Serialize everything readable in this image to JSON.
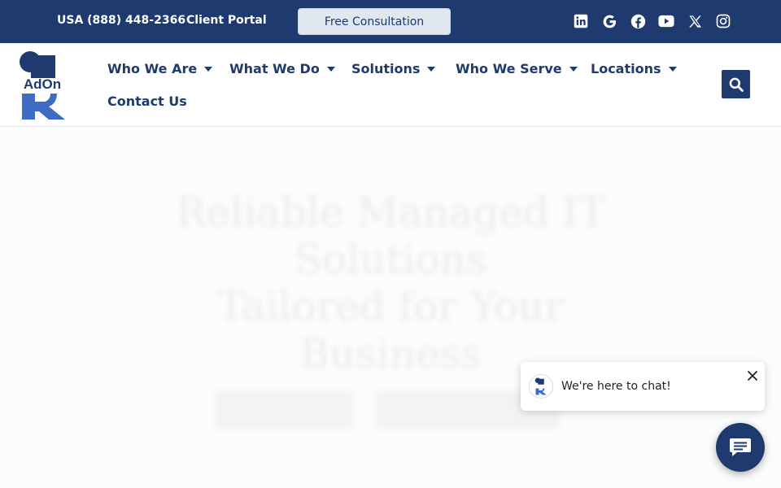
{
  "topbar": {
    "phone": "USA (888) 448-2366",
    "client_portal": "Client Portal",
    "consult_button": "Free Consultation",
    "social_icons": [
      "linkedin-icon",
      "google-icon",
      "facebook-icon",
      "youtube-icon",
      "x-icon",
      "instagram-icon"
    ]
  },
  "logo": {
    "text": "AdOn"
  },
  "nav": {
    "items": [
      {
        "label": "Who We Are",
        "dropdown": true
      },
      {
        "label": "What We Do",
        "dropdown": true
      },
      {
        "label": "Solutions",
        "dropdown": true
      },
      {
        "label": "Who We Serve",
        "dropdown": true
      },
      {
        "label": "Locations",
        "dropdown": true
      },
      {
        "label": "Contact Us",
        "dropdown": false
      }
    ],
    "search_icon": "search-icon"
  },
  "hero": {
    "headline_lines": [
      "Reliable Managed IT",
      "Solutions",
      "Tailored for Your",
      "Business"
    ]
  },
  "chat": {
    "message": "We're here to chat!",
    "close_icon": "close-icon",
    "launcher_icon": "chat-icon"
  },
  "colors": {
    "brand_navy": "#1f3a6e",
    "consult_bg": "#dfe7ef",
    "logo_blue": "#3f6bc4"
  }
}
